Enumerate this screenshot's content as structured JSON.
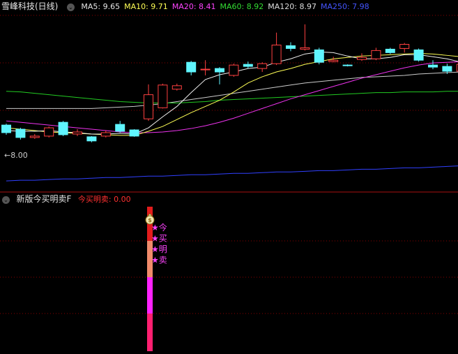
{
  "stock": {
    "title": "雪峰科技(日线)",
    "ma": [
      {
        "label": "MA5: 9.65",
        "color": "#e6e6e6"
      },
      {
        "label": "MA10: 9.71",
        "color": "#ffff55"
      },
      {
        "label": "MA20: 8.41",
        "color": "#ff44ff"
      },
      {
        "label": "MA60: 8.92",
        "color": "#33dd33"
      },
      {
        "label": "MA120: 8.97",
        "color": "#dddddd"
      },
      {
        "label": "MA250: 7.98",
        "color": "#4455ff"
      }
    ],
    "price_marker": "8.00"
  },
  "indicator": {
    "title": "新版今买明卖F",
    "value_label": "今买明卖: 0.00",
    "badge_chars": [
      "今",
      "买",
      "明",
      "卖"
    ],
    "money_bag": "$"
  },
  "colors": {
    "up": "#ff4040",
    "down": "#5ff5ff",
    "grid": "#8b0000",
    "bg": "#000000",
    "bar_red": "#e21c1c",
    "bar_salmon": "#f08a6a",
    "bar_magenta": "#ff22ff",
    "bar_crimson": "#ff1f70",
    "star": "#ff44ff"
  },
  "chart_data": {
    "type": "candlestick",
    "candles": [
      {
        "o": 8.16,
        "c": 8.05,
        "h": 8.18,
        "l": 8.02
      },
      {
        "o": 8.1,
        "c": 7.98,
        "h": 8.12,
        "l": 7.95
      },
      {
        "o": 7.98,
        "c": 8.0,
        "h": 8.03,
        "l": 7.96
      },
      {
        "o": 8.0,
        "c": 8.12,
        "h": 8.14,
        "l": 7.98
      },
      {
        "o": 8.2,
        "c": 8.02,
        "h": 8.22,
        "l": 8.0
      },
      {
        "o": 8.03,
        "c": 8.06,
        "h": 8.1,
        "l": 8.0
      },
      {
        "o": 7.99,
        "c": 7.93,
        "h": 8.0,
        "l": 7.91
      },
      {
        "o": 8.0,
        "c": 8.05,
        "h": 8.08,
        "l": 7.98
      },
      {
        "o": 8.17,
        "c": 8.07,
        "h": 8.22,
        "l": 8.05
      },
      {
        "o": 8.09,
        "c": 8.0,
        "h": 8.1,
        "l": 7.99
      },
      {
        "o": 8.25,
        "c": 8.6,
        "h": 8.75,
        "l": 8.22
      },
      {
        "o": 8.41,
        "c": 8.74,
        "h": 8.76,
        "l": 8.4
      },
      {
        "o": 8.68,
        "c": 8.73,
        "h": 8.76,
        "l": 8.66
      },
      {
        "o": 9.07,
        "c": 8.93,
        "h": 9.09,
        "l": 8.88
      },
      {
        "o": 8.96,
        "c": 8.97,
        "h": 9.1,
        "l": 8.88
      },
      {
        "o": 8.98,
        "c": 8.93,
        "h": 9.0,
        "l": 8.75
      },
      {
        "o": 8.88,
        "c": 9.03,
        "h": 9.05,
        "l": 8.86
      },
      {
        "o": 9.04,
        "c": 9.01,
        "h": 9.08,
        "l": 8.98
      },
      {
        "o": 8.98,
        "c": 9.05,
        "h": 9.07,
        "l": 8.93
      },
      {
        "o": 9.05,
        "c": 9.32,
        "h": 9.5,
        "l": 9.03
      },
      {
        "o": 9.31,
        "c": 9.27,
        "h": 9.36,
        "l": 9.23
      },
      {
        "o": 9.26,
        "c": 9.28,
        "h": 9.62,
        "l": 9.24
      },
      {
        "o": 9.25,
        "c": 9.07,
        "h": 9.28,
        "l": 9.04
      },
      {
        "o": 9.08,
        "c": 9.1,
        "h": 9.15,
        "l": 9.07
      },
      {
        "o": 9.03,
        "c": 9.02,
        "h": 9.04,
        "l": 9.01
      },
      {
        "o": 9.11,
        "c": 9.14,
        "h": 9.2,
        "l": 9.09
      },
      {
        "o": 9.12,
        "c": 9.24,
        "h": 9.28,
        "l": 9.1
      },
      {
        "o": 9.26,
        "c": 9.21,
        "h": 9.28,
        "l": 9.19
      },
      {
        "o": 9.27,
        "c": 9.33,
        "h": 9.35,
        "l": 9.21
      },
      {
        "o": 9.25,
        "c": 9.1,
        "h": 9.27,
        "l": 9.08
      },
      {
        "o": 9.03,
        "c": 9.0,
        "h": 9.1,
        "l": 8.97
      },
      {
        "o": 9.01,
        "c": 8.94,
        "h": 9.05,
        "l": 8.9
      },
      {
        "o": 8.94,
        "c": 9.04,
        "h": 9.1,
        "l": 8.92
      }
    ],
    "ma5": [
      8.08,
      8.07,
      8.07,
      8.08,
      8.06,
      8.05,
      8.03,
      8.03,
      8.04,
      8.03,
      8.12,
      8.28,
      8.43,
      8.63,
      8.82,
      8.89,
      8.93,
      8.98,
      9.0,
      9.07,
      9.12,
      9.19,
      9.22,
      9.21,
      9.16,
      9.12,
      9.12,
      9.14,
      9.18,
      9.18,
      9.15,
      9.12,
      9.07
    ],
    "ma10": [
      8.12,
      8.1,
      8.08,
      8.06,
      8.05,
      8.04,
      8.03,
      8.02,
      8.01,
      8.01,
      8.07,
      8.14,
      8.24,
      8.34,
      8.43,
      8.52,
      8.64,
      8.77,
      8.86,
      8.93,
      8.98,
      9.04,
      9.08,
      9.12,
      9.14,
      9.16,
      9.17,
      9.18,
      9.19,
      9.2,
      9.19,
      9.17,
      9.15
    ],
    "ma20": [
      8.22,
      8.2,
      8.18,
      8.16,
      8.14,
      8.12,
      8.1,
      8.08,
      8.06,
      8.05,
      8.05,
      8.06,
      8.08,
      8.11,
      8.15,
      8.2,
      8.26,
      8.33,
      8.4,
      8.47,
      8.54,
      8.6,
      8.66,
      8.72,
      8.78,
      8.84,
      8.89,
      8.94,
      8.99,
      9.03,
      9.06,
      9.07,
      9.08
    ],
    "ma60": [
      8.65,
      8.64,
      8.62,
      8.6,
      8.58,
      8.56,
      8.54,
      8.52,
      8.5,
      8.49,
      8.48,
      8.48,
      8.48,
      8.49,
      8.5,
      8.52,
      8.53,
      8.54,
      8.55,
      8.56,
      8.57,
      8.58,
      8.59,
      8.6,
      8.61,
      8.62,
      8.63,
      8.63,
      8.64,
      8.64,
      8.64,
      8.65,
      8.65
    ],
    "ma120": [
      8.4,
      8.4,
      8.4,
      8.4,
      8.4,
      8.4,
      8.4,
      8.41,
      8.42,
      8.43,
      8.45,
      8.47,
      8.5,
      8.53,
      8.56,
      8.59,
      8.62,
      8.65,
      8.68,
      8.71,
      8.74,
      8.77,
      8.79,
      8.81,
      8.83,
      8.85,
      8.86,
      8.87,
      8.88,
      8.9,
      8.91,
      8.92,
      8.93
    ],
    "ma250": [
      7.35,
      7.36,
      7.36,
      7.37,
      7.38,
      7.38,
      7.39,
      7.4,
      7.4,
      7.41,
      7.42,
      7.42,
      7.43,
      7.44,
      7.44,
      7.45,
      7.46,
      7.46,
      7.47,
      7.48,
      7.48,
      7.49,
      7.5,
      7.5,
      7.51,
      7.52,
      7.52,
      7.53,
      7.54,
      7.54,
      7.55,
      7.56,
      7.57
    ],
    "price_range": [
      7.22,
      9.75
    ],
    "indicator_bar_index": 10
  }
}
